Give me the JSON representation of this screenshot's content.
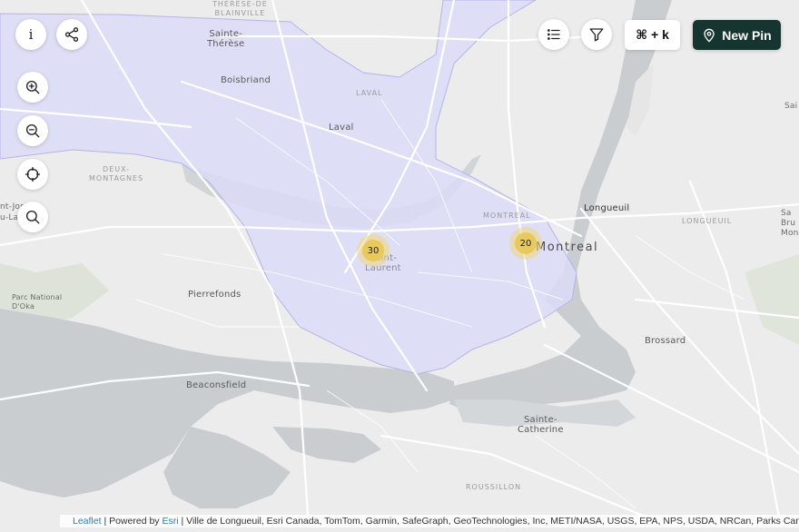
{
  "controls": {
    "info_label": "i",
    "shortcut_label": "⌘ + k",
    "new_pin_label": "New Pin"
  },
  "icons": {
    "info": "info-icon",
    "share": "share-icon",
    "zoom_in": "zoom-in-icon",
    "zoom_out": "zoom-out-icon",
    "locate": "crosshair-icon",
    "search": "search-icon",
    "list": "list-icon",
    "filter": "filter-icon",
    "pin": "map-pin-icon"
  },
  "clusters": [
    {
      "count": "30"
    },
    {
      "count": "20"
    }
  ],
  "map_labels": {
    "therese_de_blainville": "THÉRÈSE-DE\nBLAINVILLE",
    "sainte_therese": "Sainte-\nThérèse",
    "boisbriand": "Boisbriand",
    "laval_caps": "LAVAL",
    "laval": "Laval",
    "deux_montagnes": "DEUX-\nMONTAGNES",
    "saint_joseph": "nt-Joseph-\nu-Lac",
    "montreal_caps": "MONTREAL",
    "montreal": "Montreal",
    "saint_laurent": "Saint-\nLaurent",
    "longueuil": "Longueuil",
    "longueuil_caps": "LONGUEUIL",
    "pierrefonds": "Pierrefonds",
    "parc_oka": "Parc National\nD'Oka",
    "brossard": "Brossard",
    "beaconsfield": "Beaconsfield",
    "sainte_catherine": "Sainte-\nCatherine",
    "roussillon": "ROUSSILLON",
    "sai": "Sai",
    "saint_bruno": "Sa\nBru\nMon"
  },
  "attribution": {
    "leaflet": "Leaflet",
    "powered_by": " | Powered by ",
    "esri": "Esri",
    "sources": " | Ville de Longueuil, Esri Canada, TomTom, Garmin, SafeGraph, GeoTechnologies, Inc, METI/NASA, USGS, EPA, NPS, USDA, NRCan, Parks Canada"
  },
  "colors": {
    "region_fill": "#dcdcf8",
    "region_stroke": "#b4b4e8",
    "water": "#c9cdcf",
    "land": "#ececec",
    "primary_button": "#163530",
    "cluster": "#e9c95a"
  }
}
